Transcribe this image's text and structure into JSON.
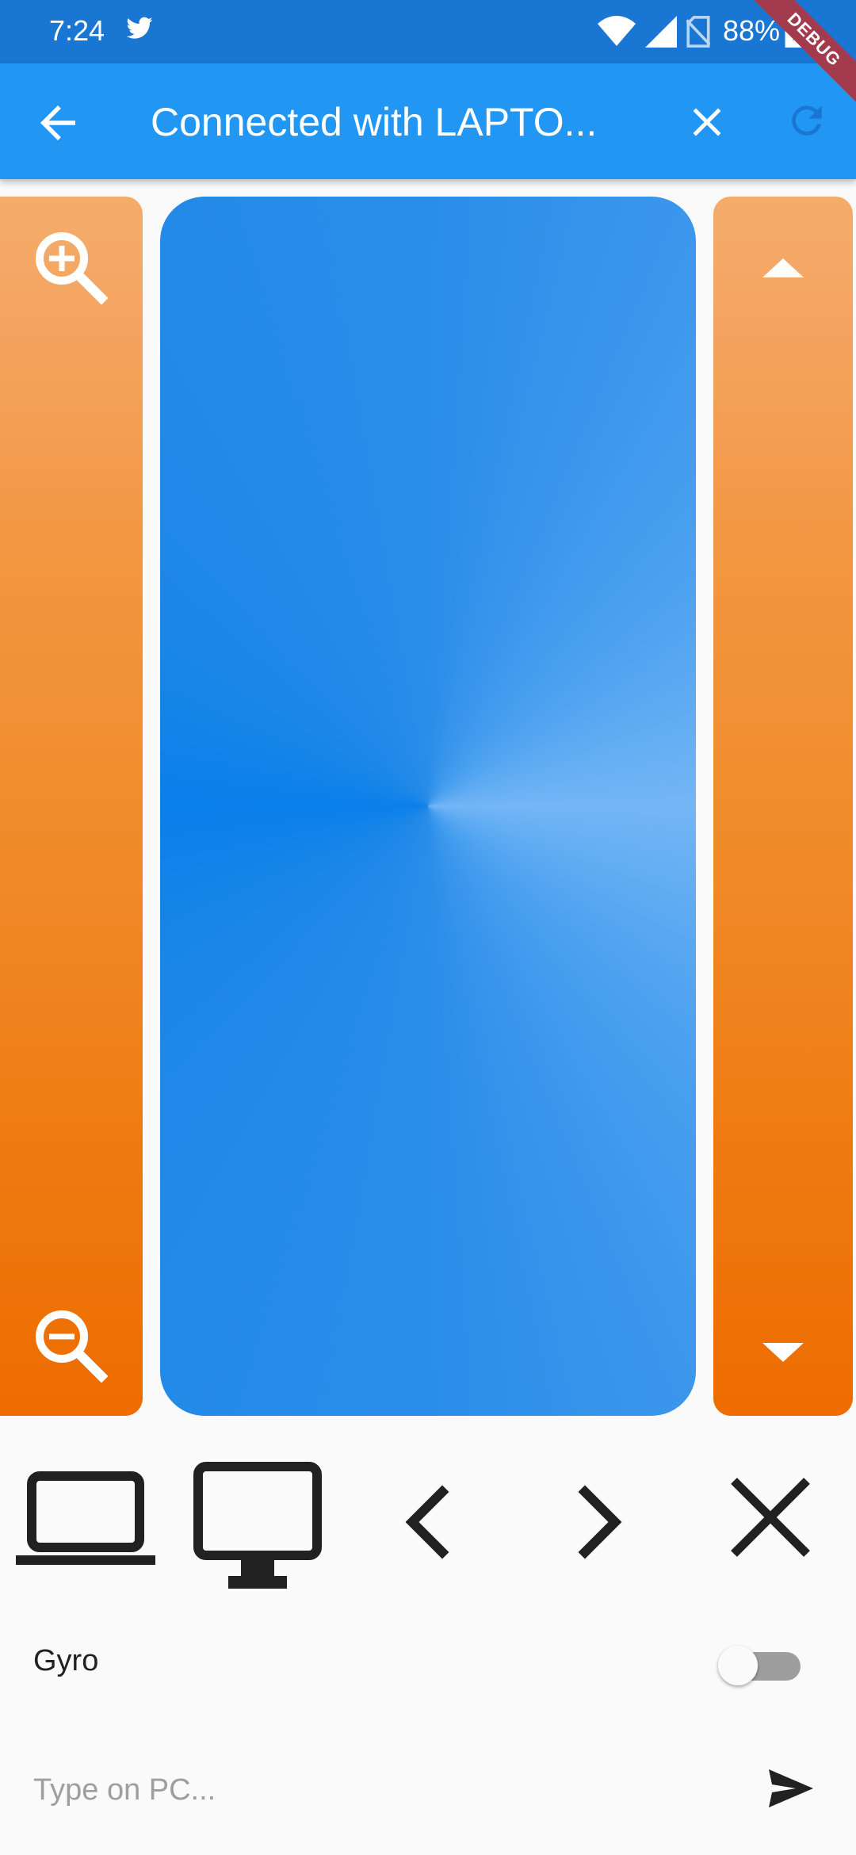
{
  "status_bar": {
    "time": "7:24",
    "battery": "88%",
    "icons": [
      "twitter-icon",
      "wifi-icon",
      "signal-icon",
      "no-sim-icon",
      "battery-charging-icon"
    ]
  },
  "debug_banner": "DEBUG",
  "app_bar": {
    "title": "Connected with LAPTO...",
    "icons": [
      "back-arrow-icon",
      "close-icon",
      "refresh-icon"
    ]
  },
  "panels": {
    "zoom": {
      "icons": [
        "zoom-in-icon",
        "zoom-out-icon"
      ]
    },
    "scroll": {
      "icons": [
        "arrow-up-icon",
        "arrow-down-icon"
      ]
    },
    "touchpad": {}
  },
  "controls": {
    "icons": [
      "laptop-icon",
      "monitor-icon",
      "chevron-left-icon",
      "chevron-right-icon",
      "close-x-icon"
    ]
  },
  "gyro": {
    "label": "Gyro",
    "enabled": false
  },
  "type_input": {
    "placeholder": "Type on PC...",
    "value": ""
  },
  "colors": {
    "status_bar": "#1976d2",
    "app_bar": "#2196f3",
    "panel_orange_top": "#f4ac6b",
    "panel_orange_bottom": "#ee6c00",
    "touchpad_blue": "#0a80ea",
    "icon_dark": "#212121"
  }
}
